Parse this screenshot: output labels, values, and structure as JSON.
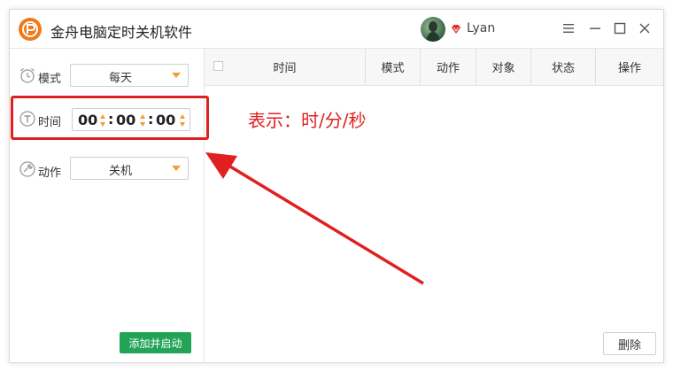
{
  "window": {
    "title": "金舟电脑定时关机软件",
    "user_name": "Lyan"
  },
  "left_panel": {
    "mode": {
      "label": "模式",
      "value": "每天"
    },
    "time": {
      "label": "时间",
      "hours": "00",
      "minutes": "00",
      "seconds": "00",
      "separator": ":"
    },
    "action": {
      "label": "动作",
      "value": "关机"
    },
    "add_start_label": "添加并启动"
  },
  "table": {
    "columns": [
      "时间",
      "模式",
      "动作",
      "对象",
      "状态",
      "操作"
    ],
    "rows": []
  },
  "delete_label": "删除",
  "annotation": "表示：时/分/秒",
  "colors": {
    "accent_orange": "#f0a030",
    "annotation_red": "#e02020",
    "button_green": "#22a356"
  },
  "icons": {
    "app": "app-logo-icon",
    "vip": "vip-diamond-icon",
    "settings": "menu-icon",
    "minimize": "minimize-icon",
    "maximize": "maximize-icon",
    "close": "close-icon",
    "mode": "alarm-clock-icon",
    "time": "timer-icon",
    "action": "power-wrench-icon"
  }
}
